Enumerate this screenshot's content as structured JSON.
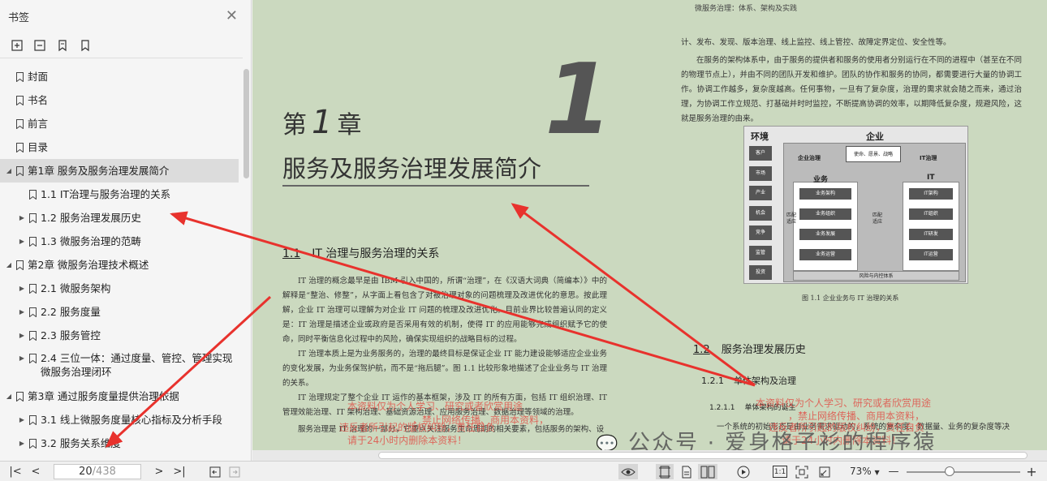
{
  "sidebar": {
    "title": "书签",
    "close_icon": "close-icon",
    "tools": [
      "expand-all-icon",
      "collapse-all-icon",
      "add-bookmark-icon",
      "bookmark-icon"
    ],
    "items": [
      {
        "label": "封面",
        "level": 0,
        "arrow": ""
      },
      {
        "label": "书名",
        "level": 0,
        "arrow": ""
      },
      {
        "label": "前言",
        "level": 0,
        "arrow": ""
      },
      {
        "label": "目录",
        "level": 0,
        "arrow": ""
      },
      {
        "label": "第1章 服务及服务治理发展简介",
        "level": 0,
        "arrow": "◢",
        "active": true
      },
      {
        "label": "1.1 IT治理与服务治理的关系",
        "level": 1,
        "arrow": ""
      },
      {
        "label": "1.2 服务治理发展历史",
        "level": 1,
        "arrow": "▶"
      },
      {
        "label": "1.3 微服务治理的范畴",
        "level": 1,
        "arrow": "▶"
      },
      {
        "label": "第2章 微服务治理技术概述",
        "level": 0,
        "arrow": "◢"
      },
      {
        "label": "2.1 微服务架构",
        "level": 1,
        "arrow": "▶"
      },
      {
        "label": "2.2 服务度量",
        "level": 1,
        "arrow": "▶"
      },
      {
        "label": "2.3 服务管控",
        "level": 1,
        "arrow": "▶"
      },
      {
        "label": "2.4 三位一体：通过度量、管控、管理实现\n微服务治理闭环",
        "level": 1,
        "arrow": "▶",
        "tall": true
      },
      {
        "label": "第3章 通过服务度量提供治理依据",
        "level": 0,
        "arrow": "◢"
      },
      {
        "label": "3.1 线上微服务度量核心指标及分析手段",
        "level": 1,
        "arrow": "▶"
      },
      {
        "label": "3.2 服务关系维度",
        "level": 1,
        "arrow": "▶"
      }
    ]
  },
  "page": {
    "running_head": "微服务治理：体系、架构及实践",
    "chapter_big_num": "1",
    "chapter_prefix_a": "第",
    "chapter_prefix_num": "1",
    "chapter_prefix_b": "章",
    "chapter_title": "服务及服务治理发展简介",
    "sec11_no": "1.1",
    "sec11_title": "IT 治理与服务治理的关系",
    "para1": "IT 治理的概念最早是由 IBM 引入中国的，所谓“治理”，在《汉语大词典（简编本）》中的解释是“整治、修整”，从字面上看包含了对被治理对象的问题梳理及改进优化的意思。按此理解，企业 IT 治理可以理解为对企业 IT 问题的梳理及改进优化。目前业界比较普遍认同的定义是：IT 治理是描述企业或政府是否采用有效的机制，使得 IT 的应用能够完成组织赋予它的使命，同时平衡信息化过程中的风险，确保实现组织的战略目标的过程。",
    "para2": "IT 治理本质上是为业务服务的，治理的最终目标是保证企业 IT 能力建设能够适应企业业务的变化发展，为业务保驾护航，而不是“拖后腿”。图 1.1 比较形象地描述了企业业务与 IT 治理的关系。",
    "para3": "IT 治理规定了整个企业 IT 运作的基本框架，涉及 IT 的所有方面，包括 IT 组织治理、IT 管理效能治理、IT 架构治理、基础资源治理、应用服务治理、数据治理等领域的治理。",
    "para4": "服务治理是 IT 治理的一部分，它重点关注服务生命周期的相关要素，包括服务的架构、设",
    "right_para0": "计、发布、发现、版本治理、线上监控、线上管控、故障定界定位、安全性等。",
    "right_para1": "在服务的架构体系中，由于服务的提供者和服务的使用者分别运行在不同的进程中（甚至在不同的物理节点上），并由不同的团队开发和维护。团队的协作和服务的协同，都需要进行大量的协调工作。协调工作越多，复杂度越高。任何事物，一旦有了复杂度，治理的需求就会随之而来，通过治理，为协调工作立规范、打基础并时时监控，不断提高协调的效率，以期降低复杂度，规避风险，这就是服务治理的由来。",
    "figure_caption": "图 1.1    企业业务与 IT 治理的关系",
    "sec12_no": "1.2",
    "sec12_title": "服务治理发展历史",
    "sec121_no": "1.2.1",
    "sec121_title": "单体架构及治理",
    "sec1211_no": "1.2.1.1",
    "sec1211_title": "单体架构的诞生",
    "right_para2": "一个系统的初始形态是由业务需求驱动的，系统的复杂度、数据量、业务的复杂度等决",
    "watermark_left_1": "本资料仅为个人学习、研究或者欣赏用途",
    "watermark_left_2": "，禁止网络传播、商用本资料，",
    "watermark_left_3": "违反者所引起的版权纠纷，责任自负",
    "watermark_left_4": "请于24小时内删除本资料！",
    "watermark_right_1": "本资料仅为个人学习、研究或者欣赏用途",
    "watermark_right_2": "，禁止网络传播、商用本资料，",
    "watermark_right_3": "违反者所引起的版权纠纷，责任自负",
    "watermark_right_4": "请于24小时内删除本资料！",
    "wechat_watermark": "公众号 · 爱身格子衫的程序猿"
  },
  "figure": {
    "env_title": "环境",
    "ent_title": "企业",
    "env_items": [
      "客户",
      "市场",
      "产业",
      "机会",
      "竞争",
      "监管",
      "投资"
    ],
    "ent_top": "使命、愿景、战略",
    "ent_gov": "企业治理",
    "it_gov": "IT治理",
    "biz_title": "业务",
    "it_title": "IT",
    "biz_items": [
      "业务架构",
      "业务组织",
      "业务发展",
      "业务运营"
    ],
    "it_items": [
      "IT架构",
      "IT组织",
      "IT研发",
      "IT运营"
    ],
    "match1": "匹配\n适应",
    "match2": "匹配\n适应",
    "bottom": "风险与内控体系"
  },
  "toolbar": {
    "page_current": "20",
    "page_total": "/438",
    "zoom": "73%",
    "zoom_level": 0.38
  }
}
